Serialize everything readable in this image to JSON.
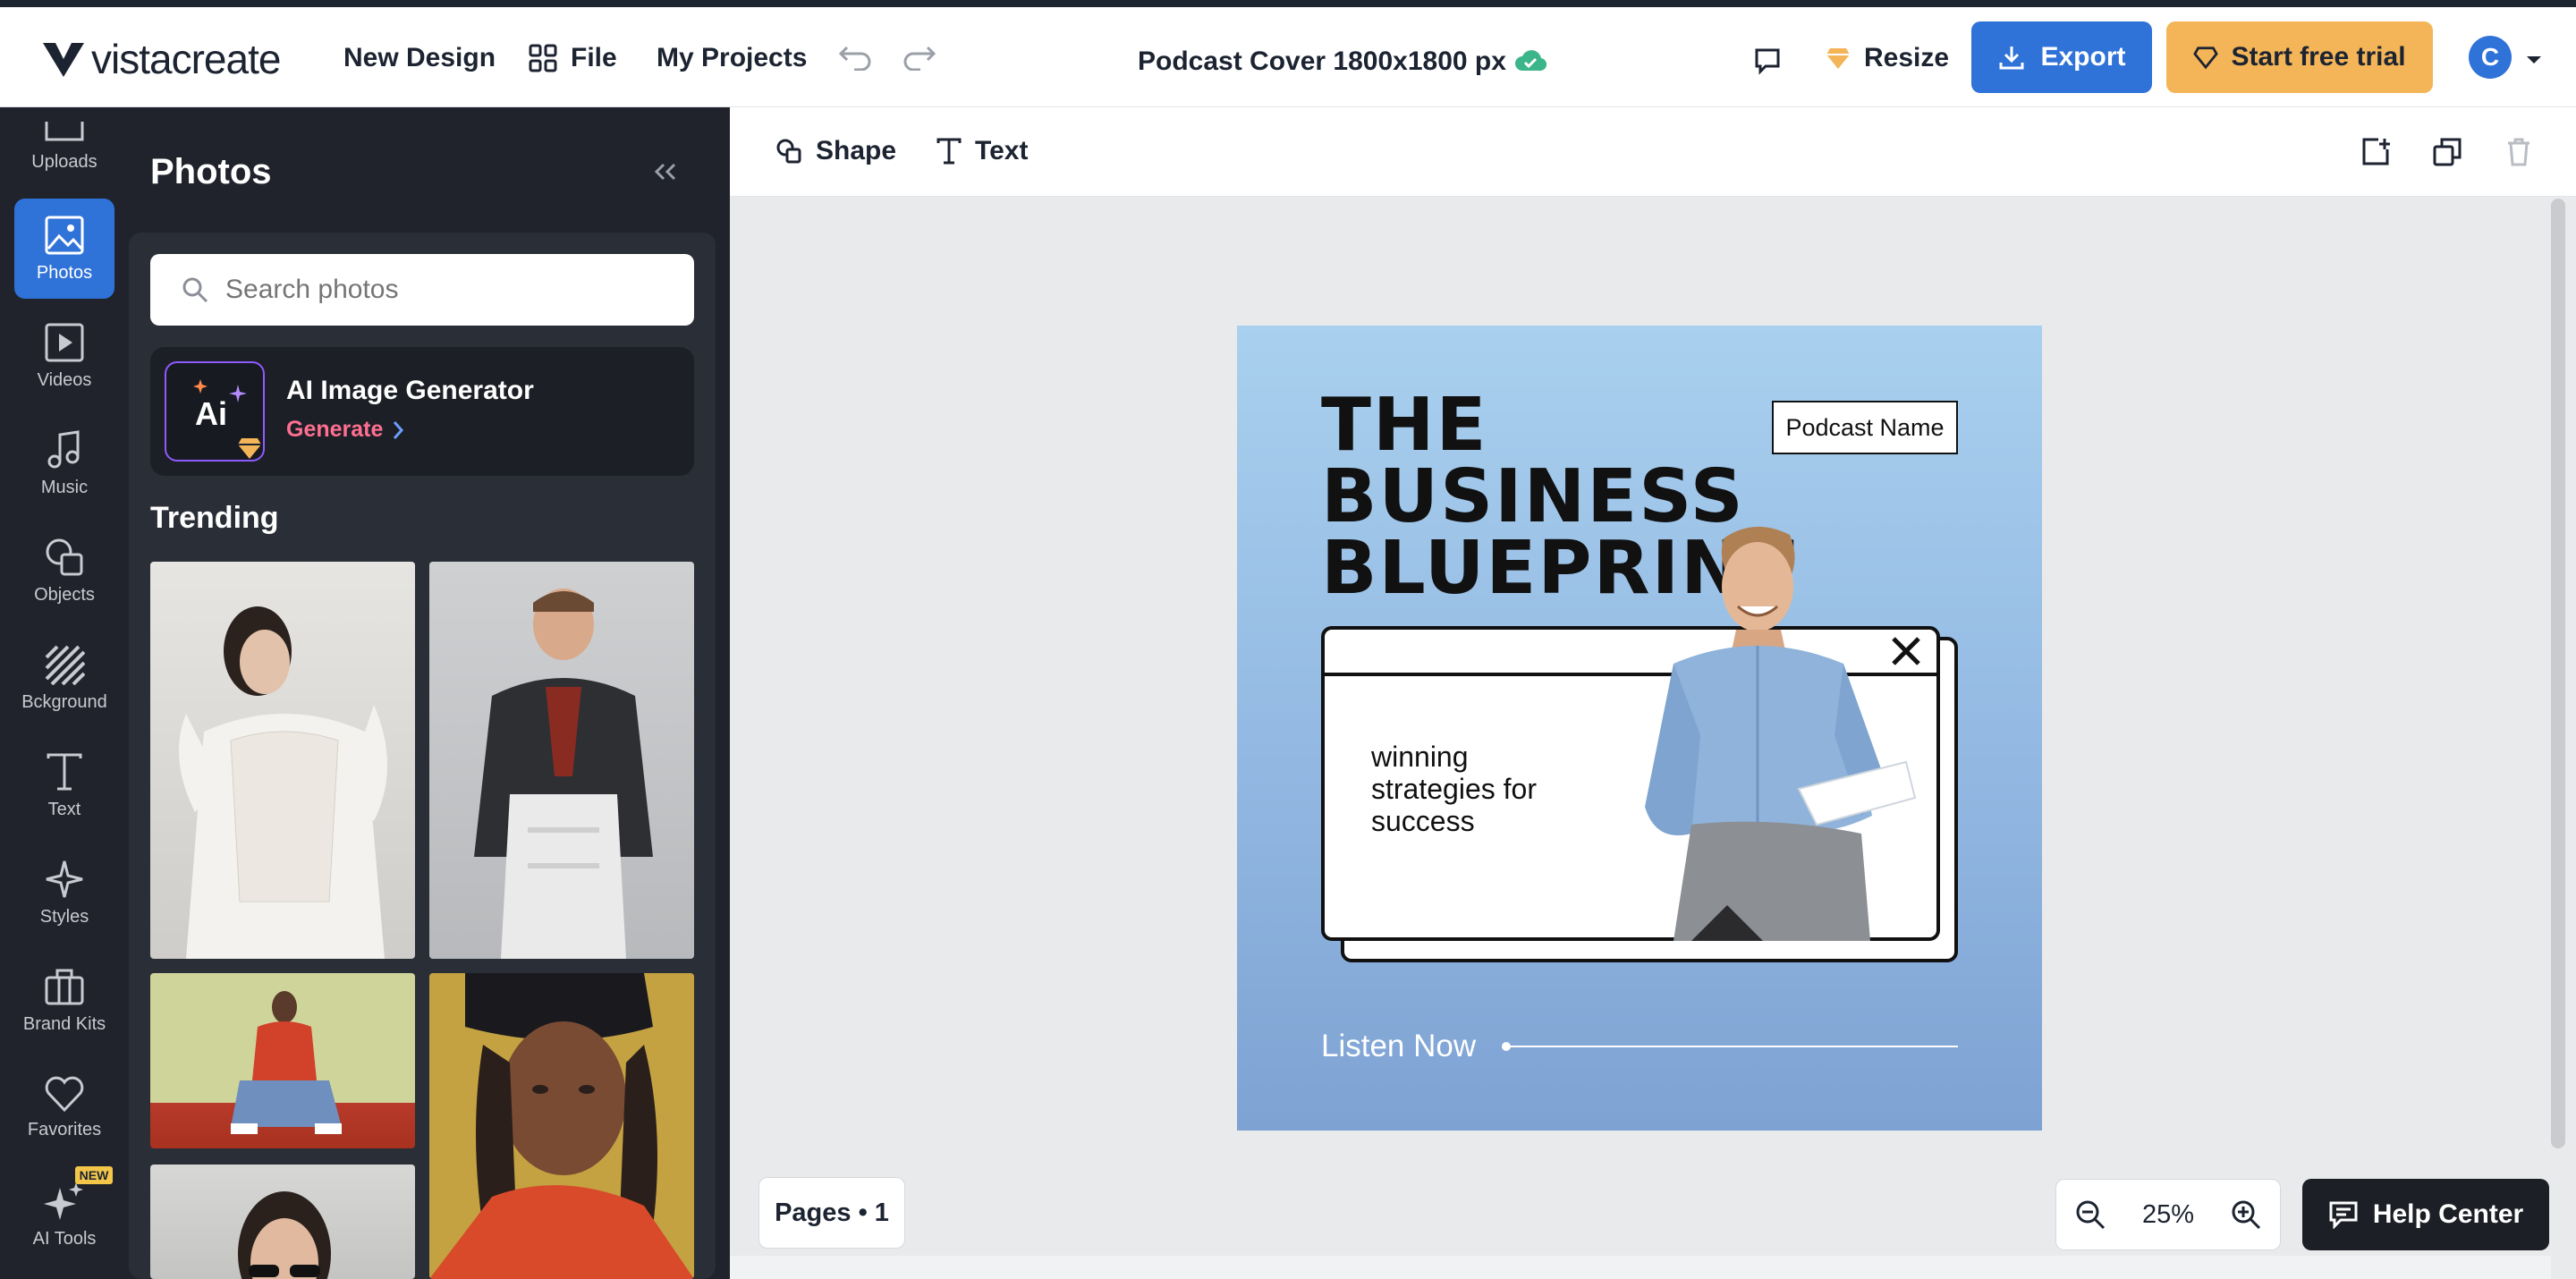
{
  "header": {
    "logo_text": "vistacreate",
    "nav": [
      "New Design",
      "File",
      "My Projects"
    ],
    "doc_title": "Podcast Cover 1800x1800 px",
    "resize_label": "Resize",
    "export_label": "Export",
    "trial_label": "Start free trial",
    "avatar_initial": "C"
  },
  "rail": {
    "items": [
      {
        "label": "Uploads",
        "icon": "upload-icon"
      },
      {
        "label": "Photos",
        "icon": "image-icon"
      },
      {
        "label": "Videos",
        "icon": "video-icon"
      },
      {
        "label": "Music",
        "icon": "music-icon"
      },
      {
        "label": "Objects",
        "icon": "objects-icon"
      },
      {
        "label": "Bckground",
        "icon": "background-icon"
      },
      {
        "label": "Text",
        "icon": "text-icon"
      },
      {
        "label": "Styles",
        "icon": "styles-icon"
      },
      {
        "label": "Brand Kits",
        "icon": "briefcase-icon"
      },
      {
        "label": "Favorites",
        "icon": "heart-icon"
      },
      {
        "label": "AI Tools",
        "icon": "sparkle-icon"
      }
    ],
    "new_badge": "NEW",
    "active": "Photos"
  },
  "panel": {
    "title": "Photos",
    "search_placeholder": "Search photos",
    "ai_title": "AI Image Generator",
    "ai_action": "Generate",
    "ai_icon_text": "Ai",
    "section": "Trending"
  },
  "toolbar": {
    "shape_label": "Shape",
    "text_label": "Text"
  },
  "design": {
    "title_lines": [
      "THE",
      "BUSINESS",
      "BLUEPRINT"
    ],
    "podcast_name": "Podcast Name",
    "tagline_lines": [
      "winning",
      "strategies for",
      "success"
    ],
    "cta": "Listen Now"
  },
  "footer": {
    "pages_label": "Pages • 1",
    "zoom_value": "25%",
    "help_label": "Help Center"
  },
  "colors": {
    "accent": "#2f72d8",
    "trial": "#f3b557",
    "sidebar": "#20232b",
    "canvas_top": "#a9d0ee",
    "canvas_bottom": "#7ea2d2"
  }
}
